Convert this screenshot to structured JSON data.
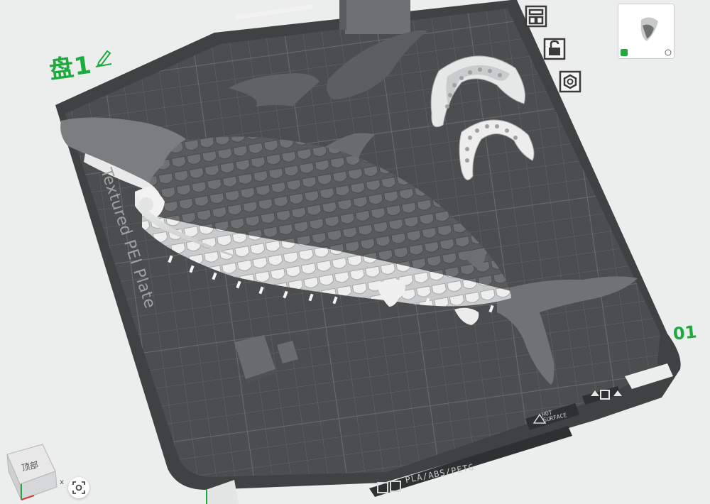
{
  "plate": {
    "name": "盘1",
    "number": "01",
    "surface_text": "Textured PEI Plate",
    "materials": "PLA/ABS/PETG",
    "hot_surface": [
      "HOT",
      "SURFACE"
    ]
  },
  "viewcube": {
    "face_label": "顶部",
    "axis_x": "x"
  },
  "side_toolbar": {
    "icons": [
      "arrange-icon",
      "lock-icon",
      "gear-nut-icon"
    ]
  },
  "thumbnail": {
    "label": "plate-thumbnail"
  },
  "colors": {
    "plate_dark": "#4b4d4e",
    "plate_grid": "#5f6263",
    "brand_green": "#1faa3f",
    "model_gray": "#7a7c7d",
    "model_light": "#e4e5e6"
  }
}
